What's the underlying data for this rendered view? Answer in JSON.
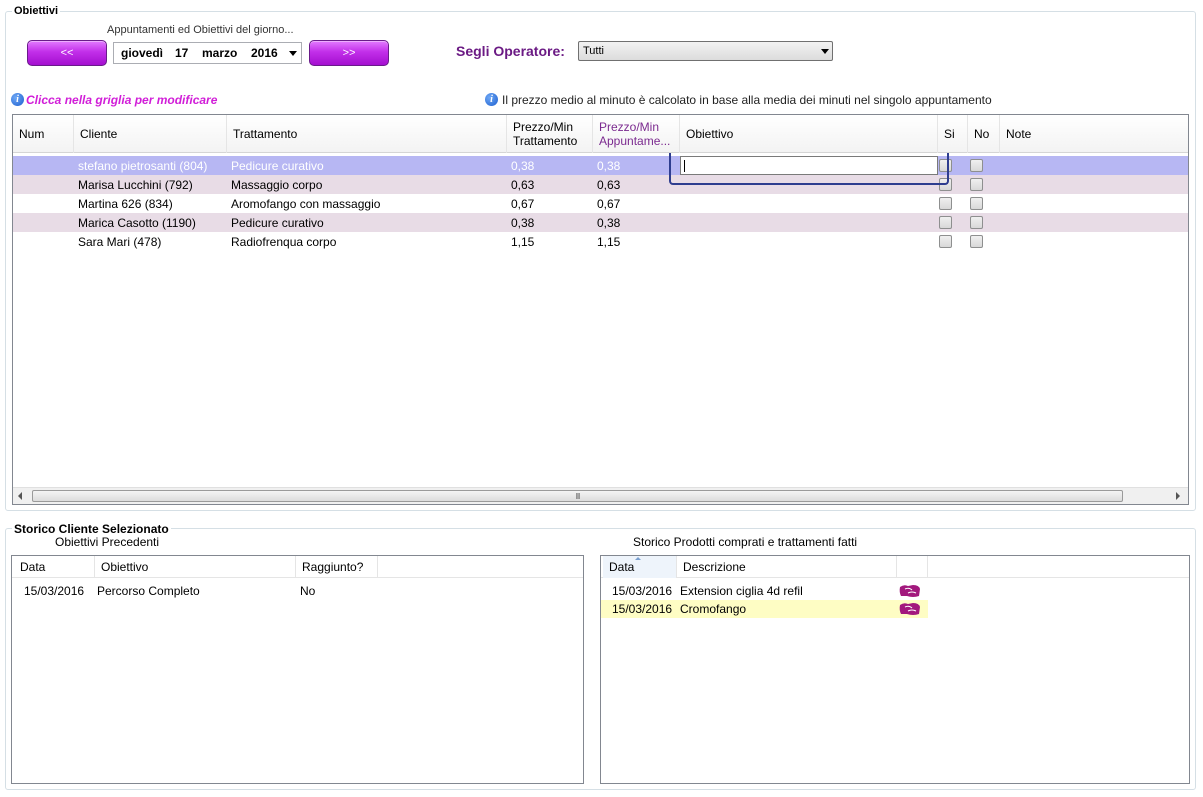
{
  "obiettivi": {
    "title": "Obiettivi",
    "subtitle": "Appuntamenti ed Obiettivi del giorno...",
    "prev_label": "<<",
    "next_label": ">>",
    "date": {
      "weekday": "giovedì",
      "day": "17",
      "month": "marzo",
      "year": "2016"
    },
    "operator_label": "Segli Operatore:",
    "operator_value": "Tutti",
    "hint_left": "Clicca nella griglia per modificare",
    "hint_right": "Il prezzo medio al minuto è calcolato in base alla media dei minuti nel singolo appuntamento"
  },
  "grid": {
    "columns": {
      "num": "Num",
      "cliente": "Cliente",
      "trattamento": "Trattamento",
      "pm_trattamento_1": "Prezzo/Min",
      "pm_trattamento_2": "Trattamento",
      "pm_appuntamento_1": "Prezzo/Min",
      "pm_appuntamento_2": "Appuntame...",
      "obiettivo": "Obiettivo",
      "si": "Si",
      "no": "No",
      "note": "Note"
    },
    "rows": [
      {
        "cliente": "stefano pietrosanti (804)",
        "trattamento": "Pedicure curativo",
        "pm_t": "0,38",
        "pm_a": "0,38"
      },
      {
        "cliente": "Marisa Lucchini (792)",
        "trattamento": "Massaggio corpo",
        "pm_t": "0,63",
        "pm_a": "0,63"
      },
      {
        "cliente": "Martina 626 (834)",
        "trattamento": "Aromofango con massaggio",
        "pm_t": "0,67",
        "pm_a": "0,67"
      },
      {
        "cliente": "Marica Casotto (1190)",
        "trattamento": "Pedicure curativo",
        "pm_t": "0,38",
        "pm_a": "0,38"
      },
      {
        "cliente": "Sara Mari (478)",
        "trattamento": "Radiofrenqua corpo",
        "pm_t": "1,15",
        "pm_a": "1,15"
      }
    ],
    "scroll_grip": "III"
  },
  "storico": {
    "title": "Storico Cliente Selezionato",
    "obiettivi_precedenti": {
      "title": "Obiettivi Precedenti",
      "columns": {
        "data": "Data",
        "obiettivo": "Obiettivo",
        "raggiunto": "Raggiunto?"
      },
      "rows": [
        {
          "data": "15/03/2016",
          "obiettivo": "Percorso Completo",
          "raggiunto": "No"
        }
      ]
    },
    "prodotti": {
      "title": "Storico Prodotti comprati e trattamenti fatti",
      "columns": {
        "data": "Data",
        "descrizione": "Descrizione"
      },
      "rows": [
        {
          "data": "15/03/2016",
          "descrizione": "Extension ciglia 4d refil"
        },
        {
          "data": "15/03/2016",
          "descrizione": "Cromofango"
        }
      ]
    }
  },
  "colors": {
    "accent": "#6b1a84",
    "hint": "#d11ed8",
    "selected_row": "#b7b7f3",
    "alt_row": "#e8dce6",
    "highlight_row": "#fefdc4",
    "purple_header": "#7b2a8f"
  }
}
